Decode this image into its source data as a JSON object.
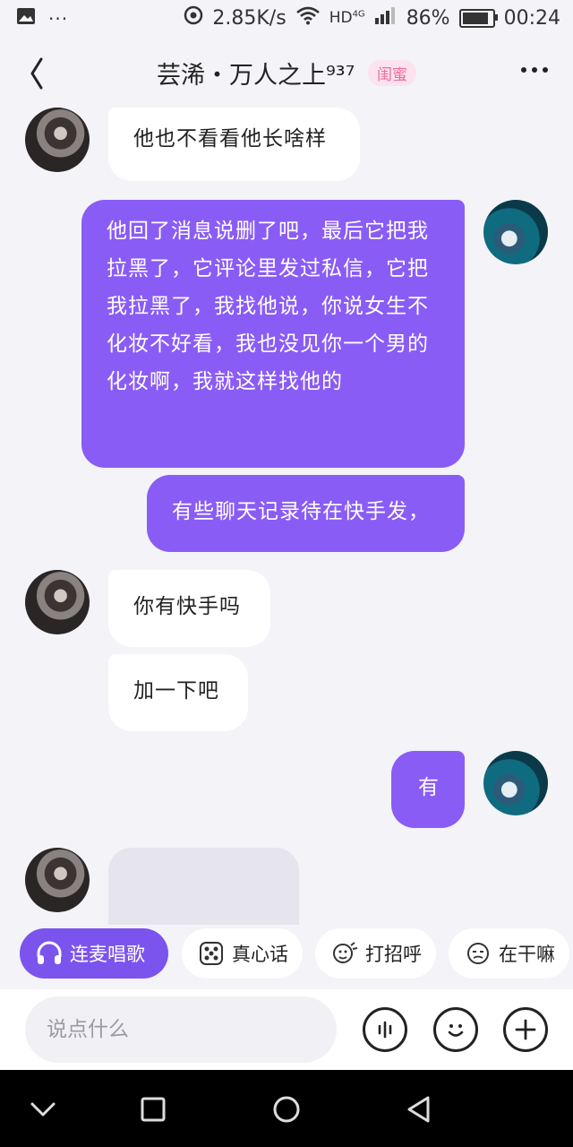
{
  "status_bar": {
    "speed": "2.85K/s",
    "network": "HD",
    "network_sup": "4G",
    "battery": "86%",
    "battery_fraction": 0.86,
    "time": "00:24"
  },
  "header": {
    "title": "芸浠・万人之上⁹³⁷",
    "tag": "闺蜜"
  },
  "messages": [
    {
      "side": "in",
      "text": "他也不看看他长啥样"
    },
    {
      "side": "out",
      "text": "他回了消息说删了吧，最后它把我拉黑了，它评论里发过私信，它把我拉黑了，我找他说，你说女生不化妆不好看，我也没见你一个男的化妆啊，我就这样找他的"
    },
    {
      "side": "out",
      "text": "有些聊天记录待在快手发，"
    },
    {
      "side": "in",
      "text": "你有快手吗"
    },
    {
      "side": "in",
      "text": "加一下吧"
    },
    {
      "side": "out",
      "text": "有"
    }
  ],
  "quick_actions": [
    {
      "label": "连麦唱歌",
      "icon": "headphones-icon"
    },
    {
      "label": "真心话",
      "icon": "dice-icon"
    },
    {
      "label": "打招呼",
      "icon": "wave-hand-icon"
    },
    {
      "label": "在干嘛",
      "icon": "face-icon"
    }
  ],
  "input": {
    "placeholder": "说点什么",
    "value": ""
  },
  "colors": {
    "accent": "#8a5cf6",
    "primary_chip": "#7b54ee",
    "tag_bg": "#fde3ee",
    "tag_text": "#f06aa0",
    "background": "#f3f3f8"
  }
}
